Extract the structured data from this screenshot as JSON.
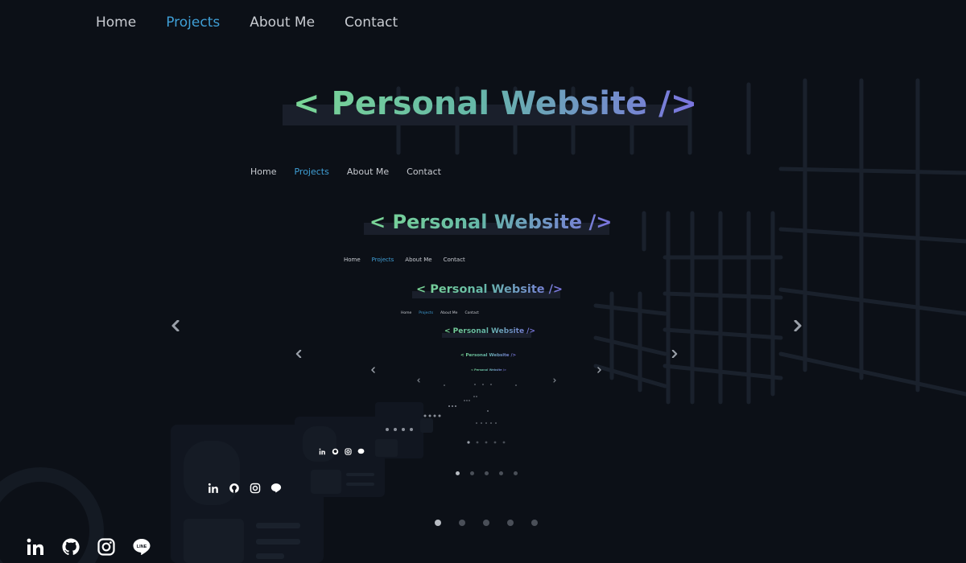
{
  "nav": {
    "items": [
      {
        "label": "Home"
      },
      {
        "label": "Projects"
      },
      {
        "label": "About Me"
      },
      {
        "label": "Contact"
      }
    ],
    "active_item": "Projects"
  },
  "hero": {
    "title": "< Personal Website />"
  },
  "carousel": {
    "slide_count": 5,
    "active_slide": 1,
    "prev_icon": "chevron-left-icon",
    "next_icon": "chevron-right-icon"
  },
  "social": [
    {
      "name": "linkedin",
      "icon": "linkedin-icon"
    },
    {
      "name": "github",
      "icon": "github-icon"
    },
    {
      "name": "instagram",
      "icon": "instagram-icon"
    },
    {
      "name": "line",
      "icon": "line-icon"
    }
  ],
  "colors": {
    "background": "#0c1017",
    "nav_text": "#c8cbd1",
    "nav_active": "#3f9fd6",
    "title_gradient_start": "#7ad696",
    "title_gradient_end": "#7b74e0",
    "dot_active": "#b7bbc2",
    "dot_inactive": "#4a4f58"
  }
}
